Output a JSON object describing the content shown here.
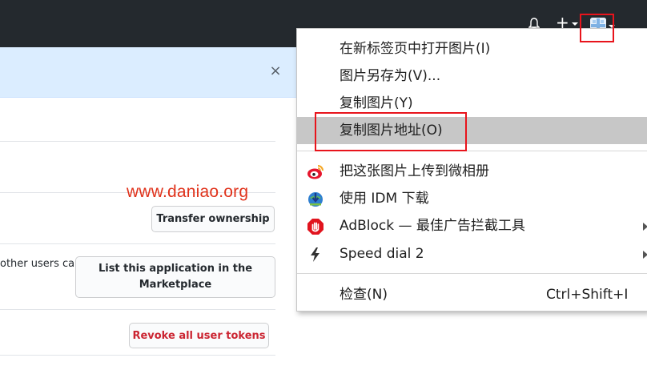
{
  "header": {
    "bell_icon": "bell-icon",
    "plus_icon": "plus-icon",
    "plus_symbol": "+",
    "avatar_icon": "user-avatar"
  },
  "flash": {
    "close_symbol": "×"
  },
  "watermark": "www.daniao.org",
  "settings": {
    "transfer_label": "Transfer ownership",
    "marketplace_label": "List this application in the Marketplace",
    "revoke_label": "Revoke all user tokens",
    "partial_text": "other users can"
  },
  "context_menu": {
    "items": [
      {
        "label": "在新标签页中打开图片(I)"
      },
      {
        "label": "图片另存为(V)..."
      },
      {
        "label": "复制图片(Y)"
      },
      {
        "label": "复制图片地址(O)",
        "highlighted": true
      },
      {
        "label": "把这张图片上传到微相册",
        "icon": "weibo-icon"
      },
      {
        "label": "使用 IDM 下载",
        "icon": "idm-icon"
      },
      {
        "label": "AdBlock — 最佳广告拦截工具",
        "icon": "adblock-icon",
        "submenu": true
      },
      {
        "label": "Speed dial 2",
        "icon": "lightning-icon",
        "submenu": true
      },
      {
        "label": "检查(N)",
        "shortcut": "Ctrl+Shift+I"
      }
    ]
  },
  "colors": {
    "header_bg": "#24292e",
    "flash_bg": "#dbedff",
    "highlight": "#c7c7c7",
    "annotation": "#e8141c",
    "watermark": "#e0321b",
    "danger": "#cb2431"
  }
}
